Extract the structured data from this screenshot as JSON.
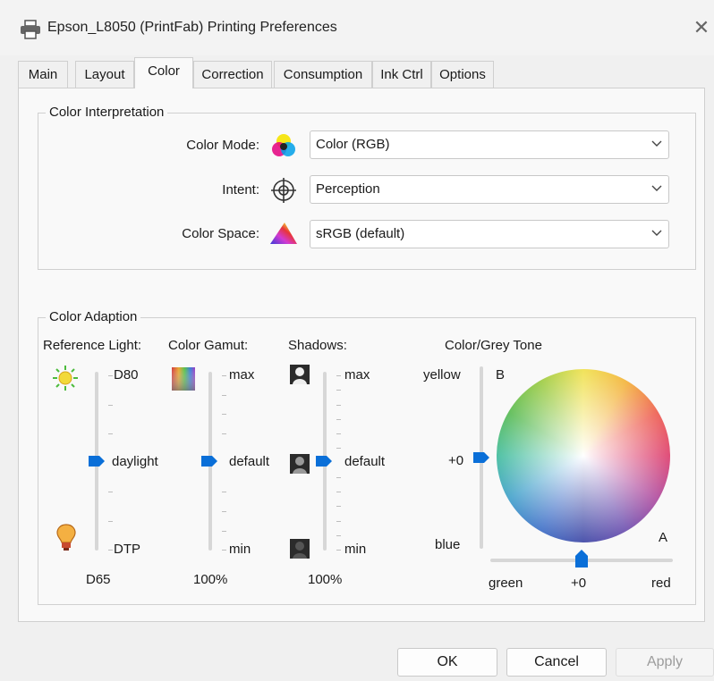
{
  "window": {
    "title": "Epson_L8050 (PrintFab) Printing Preferences",
    "close_glyph": "✕"
  },
  "tabs": [
    {
      "label": "Main"
    },
    {
      "label": "Layout"
    },
    {
      "label": "Color"
    },
    {
      "label": "Correction"
    },
    {
      "label": "Consumption"
    },
    {
      "label": "Ink Ctrl"
    },
    {
      "label": "Options"
    }
  ],
  "active_tab": "Color",
  "color_interpretation": {
    "legend": "Color Interpretation",
    "color_mode": {
      "label": "Color Mode:",
      "value": "Color (RGB)",
      "icon": "cmy-circles-icon"
    },
    "intent": {
      "label": "Intent:",
      "value": "Perception",
      "icon": "crosshair-icon"
    },
    "color_space": {
      "label": "Color Space:",
      "value": "sRGB (default)",
      "icon": "gamut-triangle-icon"
    }
  },
  "color_adaption": {
    "legend": "Color Adaption",
    "reference_light": {
      "header": "Reference Light:",
      "top": "D80",
      "mid": "daylight",
      "bottom": "DTP",
      "footer": "D65",
      "level": 0.5
    },
    "color_gamut": {
      "header": "Color Gamut:",
      "top": "max",
      "mid": "default",
      "bottom": "min",
      "footer": "100%",
      "level": 0.5
    },
    "shadows": {
      "header": "Shadows:",
      "top": "max",
      "mid": "default",
      "bottom": "min",
      "footer": "100%",
      "level": 0.5
    },
    "color_grey_tone": {
      "header": "Color/Grey Tone",
      "b_label": "B",
      "a_label": "A",
      "yellow": "yellow",
      "blue": "blue",
      "plus_zero_v": "+0",
      "green": "green",
      "red": "red",
      "plus_zero_h": "+0"
    }
  },
  "buttons": {
    "ok": "OK",
    "cancel": "Cancel",
    "apply": "Apply"
  },
  "colors": {
    "accent": "#0a6fd8",
    "track": "#d7d7d7"
  }
}
